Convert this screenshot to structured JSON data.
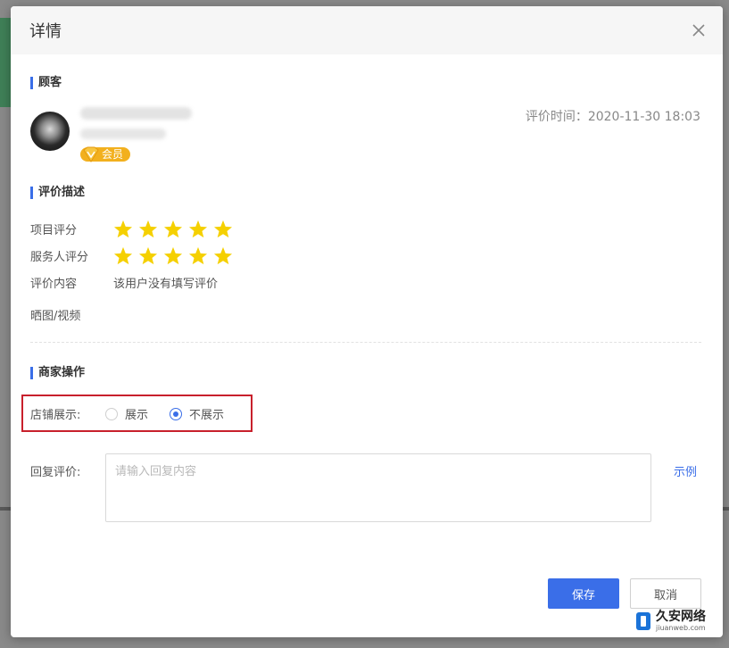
{
  "dialog": {
    "title": "详情",
    "close_icon": "close-icon"
  },
  "customer_section": {
    "title": "顾客",
    "member_badge": "会员",
    "review_time": "评价时间：2020-11-30 18:03"
  },
  "review_section": {
    "title": "评价描述",
    "project_rating_label": "项目评分",
    "project_rating": 5,
    "staff_rating_label": "服务人评分",
    "staff_rating": 5,
    "content_label": "评价内容",
    "content_value": "该用户没有填写评价",
    "media_label": "晒图/视频",
    "star_color": "#f5d000"
  },
  "merchant_section": {
    "title": "商家操作",
    "shop_display_label": "店铺展示:",
    "options": [
      "展示",
      "不展示"
    ],
    "selected": "不展示",
    "reply_label": "回复评价:",
    "reply_placeholder": "请输入回复内容",
    "example_link": "示例"
  },
  "footer": {
    "save_label": "保存",
    "cancel_label": "取消"
  },
  "watermark": {
    "cn": "久安网络",
    "en": "jiuanweb.com"
  },
  "colors": {
    "accent": "#3a6ee8",
    "highlight_border": "#c8202c",
    "badge": "#f2b01e"
  }
}
